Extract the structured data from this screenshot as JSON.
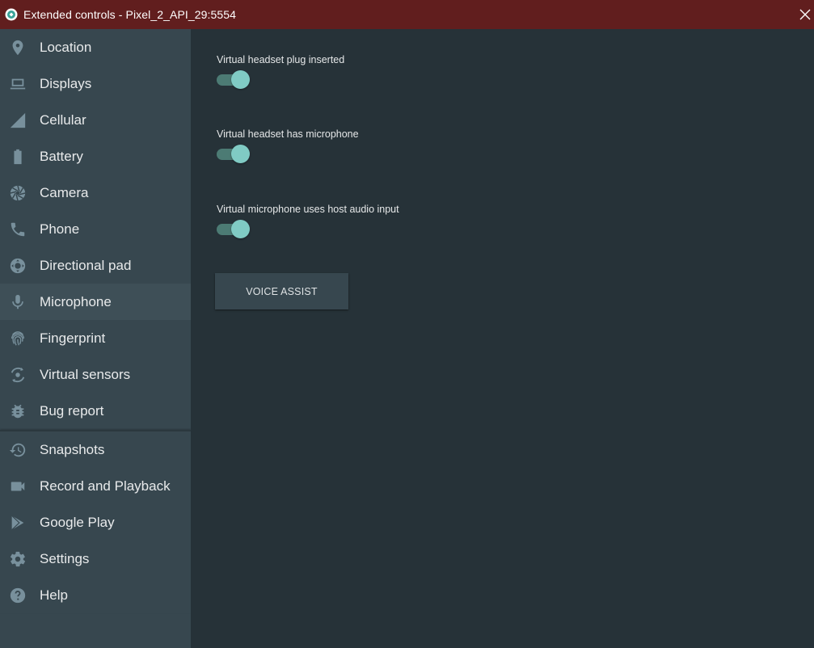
{
  "window": {
    "title": "Extended controls - Pixel_2_API_29:5554"
  },
  "sidebar": {
    "primary_items": [
      {
        "label": "Location",
        "icon": "location-pin-icon"
      },
      {
        "label": "Displays",
        "icon": "display-icon"
      },
      {
        "label": "Cellular",
        "icon": "cellular-signal-icon"
      },
      {
        "label": "Battery",
        "icon": "battery-icon"
      },
      {
        "label": "Camera",
        "icon": "camera-aperture-icon"
      },
      {
        "label": "Phone",
        "icon": "phone-icon"
      },
      {
        "label": "Directional pad",
        "icon": "dpad-icon"
      },
      {
        "label": "Microphone",
        "icon": "microphone-icon"
      },
      {
        "label": "Fingerprint",
        "icon": "fingerprint-icon"
      },
      {
        "label": "Virtual sensors",
        "icon": "rotate-sensor-icon"
      },
      {
        "label": "Bug report",
        "icon": "bug-icon"
      }
    ],
    "secondary_items": [
      {
        "label": "Snapshots",
        "icon": "history-icon"
      },
      {
        "label": "Record and Playback",
        "icon": "videocam-icon"
      },
      {
        "label": "Google Play",
        "icon": "google-play-icon"
      },
      {
        "label": "Settings",
        "icon": "gear-icon"
      },
      {
        "label": "Help",
        "icon": "help-icon"
      }
    ],
    "active_item": "Microphone"
  },
  "microphone": {
    "settings": [
      {
        "label": "Virtual headset plug inserted",
        "enabled": true
      },
      {
        "label": "Virtual headset has microphone",
        "enabled": true
      },
      {
        "label": "Virtual microphone uses host audio input",
        "enabled": true
      }
    ],
    "voice_assist_label": "VOICE ASSIST"
  },
  "colors": {
    "titlebar": "#611e1e",
    "sidebar": "#37474f",
    "content": "#263238",
    "accent": "#80cbc4",
    "icon": "#78909c"
  }
}
